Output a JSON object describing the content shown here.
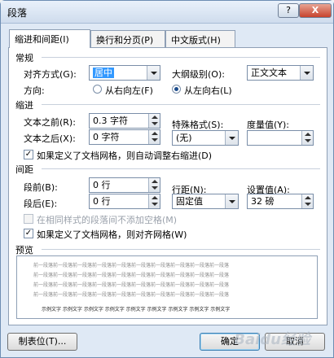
{
  "window": {
    "title": "段落",
    "help_label": "?",
    "close_label": "X"
  },
  "tabs": [
    {
      "label": "缩进和间距(I)"
    },
    {
      "label": "换行和分页(P)"
    },
    {
      "label": "中文版式(H)"
    }
  ],
  "general": {
    "heading": "常规",
    "alignment_label": "对齐方式(G):",
    "alignment_value": "居中",
    "outline_label": "大纲级别(O):",
    "outline_value": "正文文本",
    "direction_label": "方向:",
    "rtl_label": "从右向左(F)",
    "ltr_label": "从左向右(L)"
  },
  "indent": {
    "heading": "缩进",
    "before_label": "文本之前(R):",
    "before_value": "0.3 字符",
    "after_label": "文本之后(X):",
    "after_value": "0 字符",
    "special_label": "特殊格式(S):",
    "special_value": "(无)",
    "measure_label": "度量值(Y):",
    "measure_value": "",
    "auto_adjust_label": "如果定义了文档网格，则自动调整右缩进(D)"
  },
  "spacing": {
    "heading": "间距",
    "before_label": "段前(B):",
    "before_value": "0 行",
    "after_label": "段后(E):",
    "after_value": "0 行",
    "line_label": "行距(N):",
    "line_value": "固定值",
    "at_label": "设置值(A):",
    "at_value": "32 磅",
    "no_space_label": "在相同样式的段落间不添加空格(M)",
    "snap_grid_label": "如果定义了文档网格，则对齐网格(W)"
  },
  "preview": {
    "heading": "预览",
    "prev_text": "前一段落前一段落前一段落前一段落前一段落前一段落前一段落前一段落前一段落前一段落",
    "sample_text": "示例文字 示例文字 示例文字 示例文字 示例文字 示例文字 示例文字 示例文字 示例文字"
  },
  "footer": {
    "tabs_button": "制表位(T)...",
    "ok_button": "确定",
    "cancel_button": "取消"
  },
  "watermark": "Baidu经验"
}
